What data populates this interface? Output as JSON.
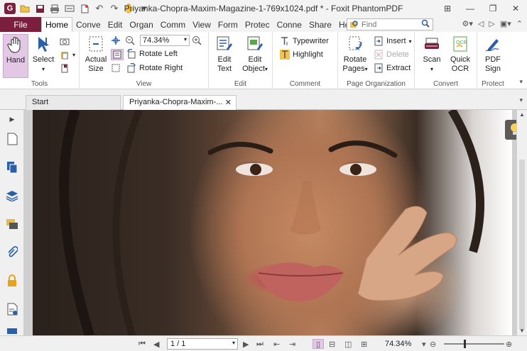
{
  "window": {
    "title": "Priyanka-Chopra-Maxim-Magazine-1-769x1024.pdf * - Foxit PhantomPDF"
  },
  "ribbon_tabs": [
    "File",
    "Home",
    "Conve",
    "Edit",
    "Organ",
    "Comm",
    "View",
    "Form",
    "Protec",
    "Conne",
    "Share",
    "Help"
  ],
  "search": {
    "placeholder": "Find"
  },
  "groups": {
    "tools": {
      "label": "Tools",
      "hand": "Hand",
      "select": "Select"
    },
    "view": {
      "label": "View",
      "actual_size_1": "Actual",
      "actual_size_2": "Size",
      "zoom_value": "74.34%",
      "rotate_left": "Rotate Left",
      "rotate_right": "Rotate Right"
    },
    "edit": {
      "label": "Edit",
      "edit_text_1": "Edit",
      "edit_text_2": "Text",
      "edit_object_1": "Edit",
      "edit_object_2": "Object"
    },
    "comment": {
      "label": "Comment",
      "typewriter": "Typewriter",
      "highlight": "Highlight"
    },
    "page_org": {
      "label": "Page Organization",
      "rotate_pages_1": "Rotate",
      "rotate_pages_2": "Pages",
      "insert": "Insert",
      "delete": "Delete",
      "extract": "Extract"
    },
    "convert": {
      "label": "Convert",
      "scan": "Scan",
      "quick_ocr_1": "Quick",
      "quick_ocr_2": "OCR"
    },
    "protect": {
      "label": "Protect",
      "pdf_sign_1": "PDF",
      "pdf_sign_2": "Sign"
    }
  },
  "doc_tabs": {
    "start": "Start",
    "current": "Priyanka-Chopra-Maxim-..."
  },
  "status": {
    "page": "1 / 1",
    "zoom": "74.34%"
  },
  "colors": {
    "file_tab": "#7a1f3d",
    "active_tool": "#e3c8e6"
  }
}
